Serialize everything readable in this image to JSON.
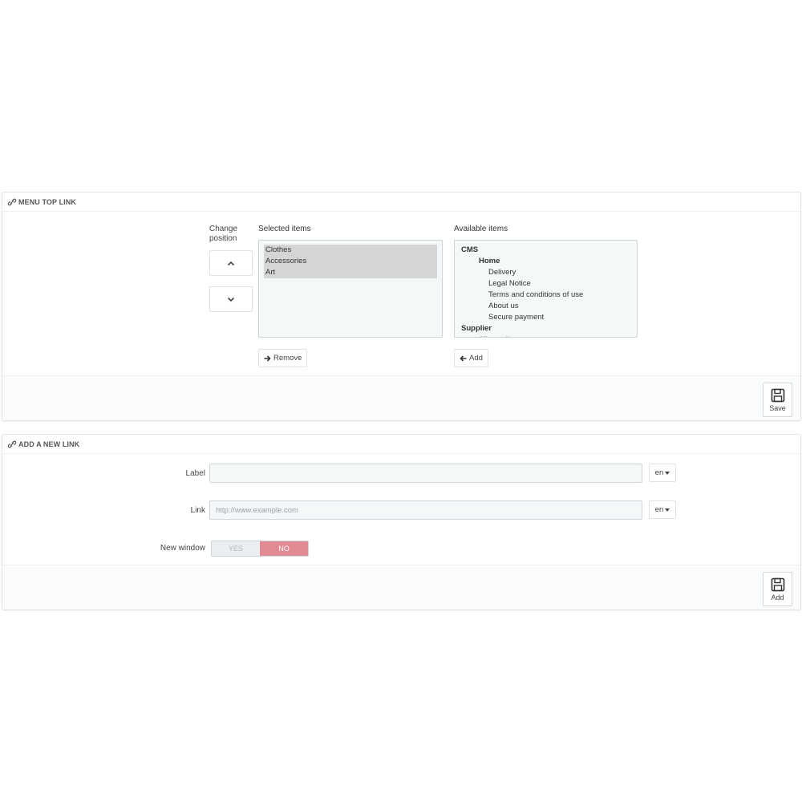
{
  "menu_top_link": {
    "title": "MENU TOP LINK",
    "change_position_line1": "Change",
    "change_position_line2": "position",
    "selected_label": "Selected items",
    "available_label": "Available items",
    "selected_items": [
      "Clothes",
      "Accessories",
      "Art"
    ],
    "available_items": [
      {
        "text": "CMS",
        "level": 0,
        "group": true
      },
      {
        "text": "Home",
        "level": 1,
        "group": true
      },
      {
        "text": "Delivery",
        "level": 2,
        "group": false
      },
      {
        "text": "Legal Notice",
        "level": 2,
        "group": false
      },
      {
        "text": "Terms and conditions of use",
        "level": 2,
        "group": false
      },
      {
        "text": "About us",
        "level": 2,
        "group": false
      },
      {
        "text": "Secure payment",
        "level": 2,
        "group": false
      },
      {
        "text": "Supplier",
        "level": 0,
        "group": true
      },
      {
        "text": "All suppliers",
        "level": 1,
        "group": false
      }
    ],
    "remove_label": "Remove",
    "add_label": "Add",
    "save_label": "Save"
  },
  "add_new_link": {
    "title": "ADD A NEW LINK",
    "label_field": "Label",
    "label_value": "",
    "link_field": "Link",
    "link_placeholder": "http://www.example.com",
    "lang_label": "en",
    "lang_link": "en",
    "new_window_label": "New window",
    "yes_label": "YES",
    "no_label": "NO",
    "add_label": "Add"
  }
}
